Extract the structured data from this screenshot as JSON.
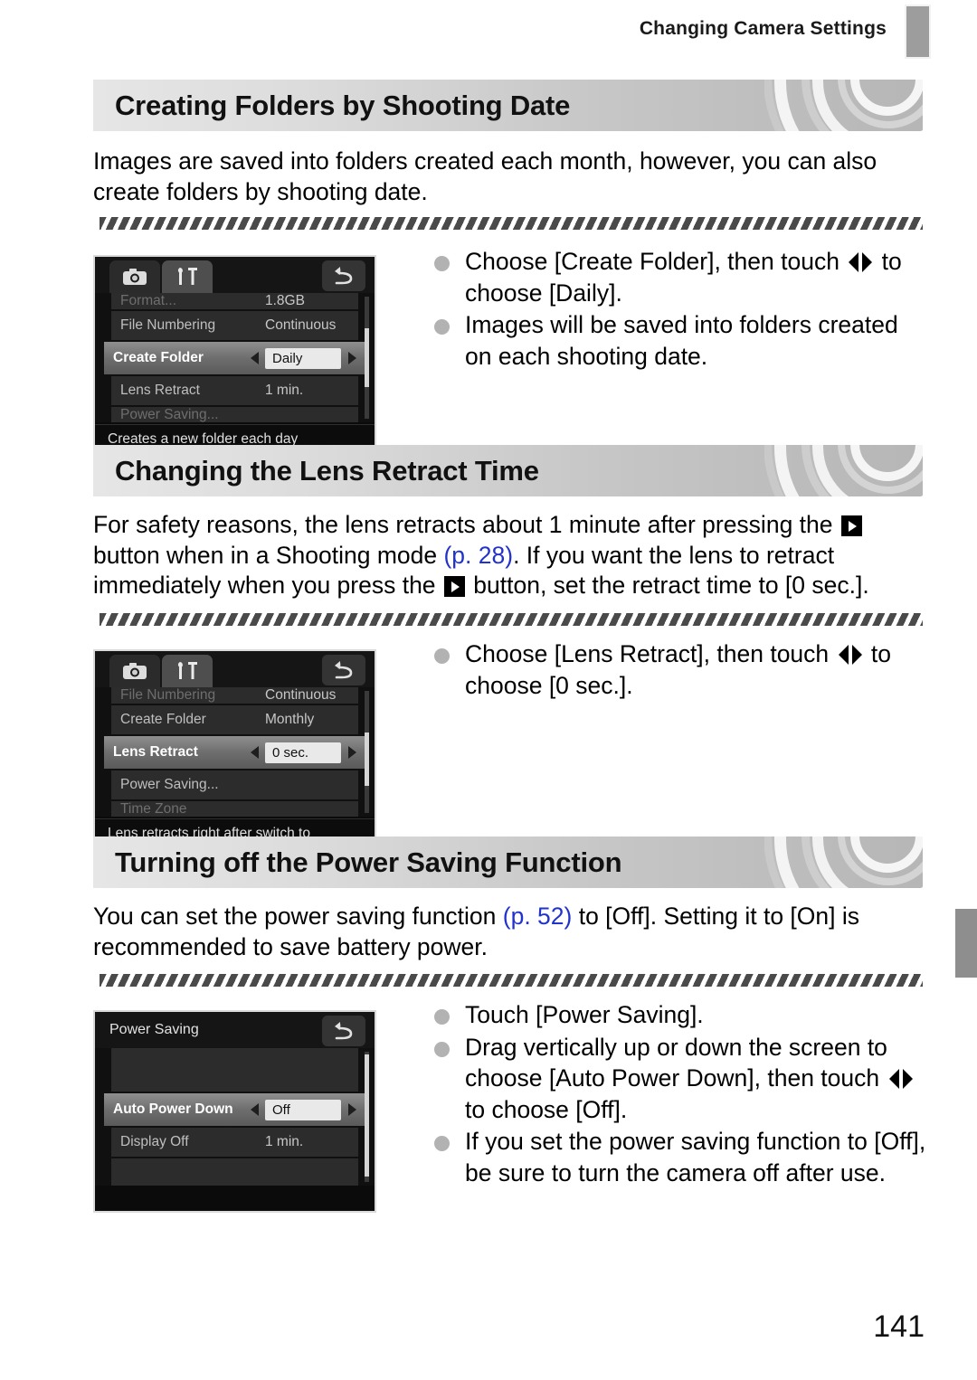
{
  "header": {
    "running_title": "Changing Camera Settings"
  },
  "page": {
    "number": "141"
  },
  "sections": [
    {
      "heading": "Creating Folders by Shooting Date",
      "body_parts": [
        {
          "t": "Images are saved into folders created each month, however, you can also create folders by shooting date."
        }
      ],
      "screen": {
        "type": "menu-tabs",
        "tab_shoot_icon": "camera-icon",
        "tab_setup_icon": "wrench-screwdriver-icon",
        "return_icon": "return-arrow-icon",
        "rows": [
          {
            "label": "Format...",
            "value": "1.8GB",
            "state": "clipped-top"
          },
          {
            "label": "File Numbering",
            "value": "Continuous",
            "state": "normal"
          },
          {
            "label": "Create Folder",
            "value": "Daily",
            "state": "selected"
          },
          {
            "label": "Lens Retract",
            "value": "1 min.",
            "state": "normal"
          },
          {
            "label": "Power Saving...",
            "value": "",
            "state": "clipped-bottom"
          }
        ],
        "hint": "Creates a new folder each day"
      },
      "bullets": [
        {
          "parts": [
            {
              "t": "Choose [Create Folder], then touch "
            },
            {
              "icon": "left-right-arrows-icon"
            },
            {
              "t": " to choose [Daily]."
            }
          ]
        },
        {
          "parts": [
            {
              "t": "Images will be saved into folders created on each shooting date."
            }
          ]
        }
      ]
    },
    {
      "heading": "Changing the Lens Retract Time",
      "body_parts": [
        {
          "t": "For safety reasons, the lens retracts about 1 minute after pressing the "
        },
        {
          "icon": "playback-button-icon"
        },
        {
          "t": " button when in a Shooting mode "
        },
        {
          "ref": "(p. 28)"
        },
        {
          "t": ". If you want the lens to retract immediately when you press the "
        },
        {
          "icon": "playback-button-icon"
        },
        {
          "t": " button, set the retract time to [0 sec.]."
        }
      ],
      "screen": {
        "type": "menu-tabs",
        "tab_shoot_icon": "camera-icon",
        "tab_setup_icon": "wrench-screwdriver-icon",
        "return_icon": "return-arrow-icon",
        "rows": [
          {
            "label": "File Numbering",
            "value": "Continuous",
            "state": "clipped-top"
          },
          {
            "label": "Create Folder",
            "value": "Monthly",
            "state": "normal"
          },
          {
            "label": "Lens Retract",
            "value": "0 sec.",
            "state": "selected"
          },
          {
            "label": "Power Saving...",
            "value": "",
            "state": "normal"
          },
          {
            "label": "Time Zone",
            "value": "",
            "state": "clipped-bottom"
          }
        ],
        "hint": "Lens retracts right after switch to Playback mode"
      },
      "bullets": [
        {
          "parts": [
            {
              "t": "Choose [Lens Retract], then touch "
            },
            {
              "icon": "left-right-arrows-icon"
            },
            {
              "t": " to choose [0 sec.]."
            }
          ]
        }
      ]
    },
    {
      "heading": "Turning off the Power Saving Function",
      "body_parts": [
        {
          "t": "You can set the power saving function "
        },
        {
          "ref": "(p. 52)"
        },
        {
          "t": " to [Off]. Setting it to [On] is recommended to save battery power."
        }
      ],
      "screen": {
        "type": "submenu",
        "title": "Power Saving",
        "return_icon": "return-arrow-icon",
        "rows": [
          {
            "label": "",
            "value": "",
            "state": "blank"
          },
          {
            "label": "Auto Power Down",
            "value": "Off",
            "state": "selected"
          },
          {
            "label": "Display Off",
            "value": "1 min.",
            "state": "normal"
          },
          {
            "label": "",
            "value": "",
            "state": "blank"
          }
        ],
        "hint": ""
      },
      "bullets": [
        {
          "parts": [
            {
              "t": "Touch [Power Saving]."
            }
          ]
        },
        {
          "parts": [
            {
              "t": "Drag vertically up or down the screen to choose [Auto Power Down], then touch "
            },
            {
              "icon": "left-right-arrows-icon"
            },
            {
              "t": " to choose [Off]."
            }
          ]
        },
        {
          "parts": [
            {
              "t": "If you set the power saving function to [Off], be sure to turn the camera off after use."
            }
          ]
        }
      ]
    }
  ]
}
